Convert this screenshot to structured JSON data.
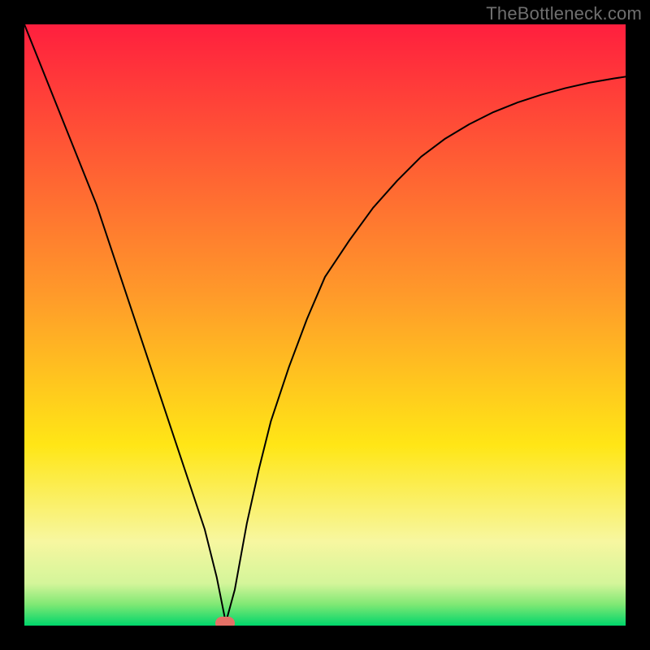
{
  "watermark": "TheBottleneck.com",
  "chart_data": {
    "type": "line",
    "title": "",
    "xlabel": "",
    "ylabel": "",
    "xlim": [
      0,
      100
    ],
    "ylim": [
      0,
      100
    ],
    "background_gradient": {
      "stops": [
        {
          "offset": 0.0,
          "color": "#ff1f3e"
        },
        {
          "offset": 0.45,
          "color": "#ff9a2a"
        },
        {
          "offset": 0.7,
          "color": "#ffe616"
        },
        {
          "offset": 0.86,
          "color": "#f7f7a0"
        },
        {
          "offset": 0.93,
          "color": "#d4f59a"
        },
        {
          "offset": 0.965,
          "color": "#7fe874"
        },
        {
          "offset": 1.0,
          "color": "#00d66b"
        }
      ]
    },
    "series": [
      {
        "name": "bottleneck-curve",
        "color": "#000000",
        "stroke_width": 2,
        "x": [
          0,
          2,
          4,
          6,
          8,
          10,
          12,
          14,
          16,
          18,
          20,
          22,
          24,
          26,
          28,
          30,
          32,
          33.5,
          35,
          37,
          39,
          41,
          44,
          47,
          50,
          54,
          58,
          62,
          66,
          70,
          74,
          78,
          82,
          86,
          90,
          94,
          98,
          100
        ],
        "y": [
          100,
          95,
          90,
          85,
          80,
          75,
          70,
          64,
          58,
          52,
          46,
          40,
          34,
          28,
          22,
          16,
          8,
          0.5,
          6,
          17,
          26,
          34,
          43,
          51,
          58,
          64,
          69.5,
          74,
          78,
          81,
          83.4,
          85.4,
          87,
          88.3,
          89.4,
          90.3,
          91,
          91.3
        ]
      }
    ],
    "marker": {
      "x": 33.4,
      "y": 0.4,
      "color": "#e47066"
    }
  }
}
